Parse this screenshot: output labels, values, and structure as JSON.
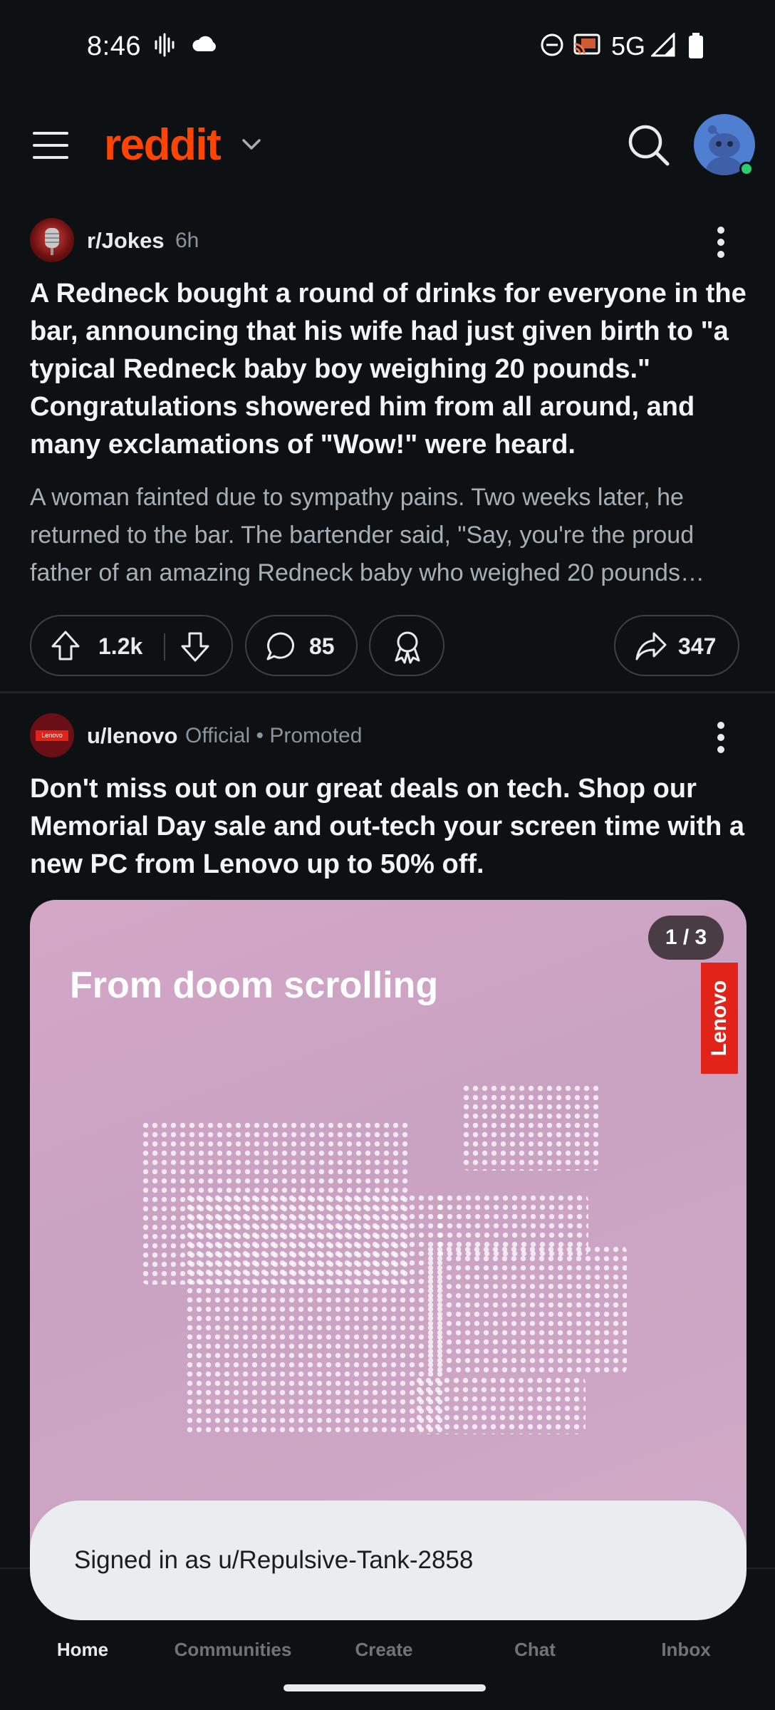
{
  "status_bar": {
    "time": "8:46",
    "network": "5G"
  },
  "header": {
    "logo": "reddit"
  },
  "posts": [
    {
      "subreddit": "r/Jokes",
      "age": "6h",
      "title": "A Redneck bought a round of drinks for everyone in the bar, announcing that his wife had just given birth to \"a typical Redneck baby boy weighing 20 pounds.\" Congratulations showered him from all around, and many exclamations of \"Wow!\" were heard.",
      "body": "A woman fainted due to sympathy pains. Two weeks later, he returned to the bar. The bartender said, \"Say, you're the proud father of an amazing Redneck baby who weighed 20 pounds…",
      "votes": "1.2k",
      "comments": "85",
      "shares": "347"
    },
    {
      "user": "u/lenovo",
      "official_label": "Official",
      "promoted_label": "• Promoted",
      "title": "Don't miss out on our great deals on tech. Shop our Memorial Day sale and out-tech your screen time with a new PC from Lenovo up to 50% off.",
      "image_headline": "From doom scrolling",
      "image_counter": "1 / 3",
      "brand_tag": "Lenovo",
      "avatar_text": "Lenovo"
    }
  ],
  "toast": {
    "text": "Signed in as u/Repulsive-Tank-2858"
  },
  "bottom_nav": [
    {
      "label": "Home",
      "active": true
    },
    {
      "label": "Communities",
      "active": false
    },
    {
      "label": "Create",
      "active": false
    },
    {
      "label": "Chat",
      "active": false
    },
    {
      "label": "Inbox",
      "active": false
    }
  ],
  "colors": {
    "brand": "#ff4500",
    "background": "#0e1113",
    "toast": "#e9edf0"
  }
}
